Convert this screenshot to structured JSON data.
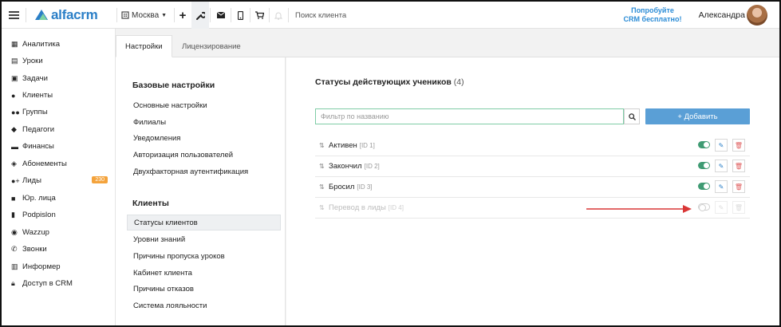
{
  "header": {
    "logo_text": "alfacrm",
    "branch": "Москва",
    "search_label": "Поиск клиента",
    "promo_line1": "Попробуйте",
    "promo_line2": "CRM бесплатно!",
    "user_name": "Александра",
    "icons": [
      "menu-icon",
      "plus-icon",
      "wrench-icon",
      "mail-icon",
      "phone-icon",
      "cart-icon",
      "bell-icon"
    ]
  },
  "sidebar": {
    "items": [
      {
        "label": "Аналитика",
        "icon": "map-icon"
      },
      {
        "label": "Уроки",
        "icon": "calendar-icon"
      },
      {
        "label": "Задачи",
        "icon": "clipboard-icon"
      },
      {
        "label": "Клиенты",
        "icon": "user-icon"
      },
      {
        "label": "Группы",
        "icon": "users-icon"
      },
      {
        "label": "Педагоги",
        "icon": "graduation-cap-icon"
      },
      {
        "label": "Финансы",
        "icon": "money-icon"
      },
      {
        "label": "Абонементы",
        "icon": "tag-icon"
      },
      {
        "label": "Лиды",
        "icon": "user-plus-icon",
        "badge": "230"
      },
      {
        "label": "Юр. лица",
        "icon": "briefcase-icon"
      },
      {
        "label": "Podpislon",
        "icon": "document-icon"
      },
      {
        "label": "Wazzup",
        "icon": "whatsapp-icon"
      },
      {
        "label": "Звонки",
        "icon": "phone-icon"
      },
      {
        "label": "Информер",
        "icon": "window-icon"
      },
      {
        "label": "Доступ в CRM",
        "icon": "lock-icon"
      }
    ]
  },
  "tabs": [
    {
      "label": "Настройки",
      "active": true
    },
    {
      "label": "Лицензирование",
      "active": false
    }
  ],
  "menu": {
    "basic_title": "Базовые настройки",
    "basic_items": [
      "Основные настройки",
      "Филиалы",
      "Уведомления",
      "Авторизация пользователей",
      "Двухфакторная аутентификация"
    ],
    "clients_title": "Клиенты",
    "clients_items": [
      "Статусы клиентов",
      "Уровни знаний",
      "Причины пропуска уроков",
      "Кабинет клиента",
      "Причины отказов",
      "Система лояльности"
    ],
    "active_item": "Статусы клиентов"
  },
  "content": {
    "title": "Статусы действующих учеников",
    "count": "(4)",
    "filter_placeholder": "Фильтр по названию",
    "add_label": "+ Добавить",
    "statuses": [
      {
        "name": "Активен",
        "id": "[ID 1]",
        "enabled": true
      },
      {
        "name": "Закончил",
        "id": "[ID 2]",
        "enabled": true
      },
      {
        "name": "Бросил",
        "id": "[ID 3]",
        "enabled": true
      },
      {
        "name": "Перевод в лиды",
        "id": "[ID 4]",
        "enabled": false
      }
    ]
  },
  "colors": {
    "brand": "#2b7fc7",
    "toggle_on": "#3f9b73",
    "add_button": "#5a9fd6",
    "badge": "#f4a33c",
    "annotation_arrow": "#d93636"
  }
}
